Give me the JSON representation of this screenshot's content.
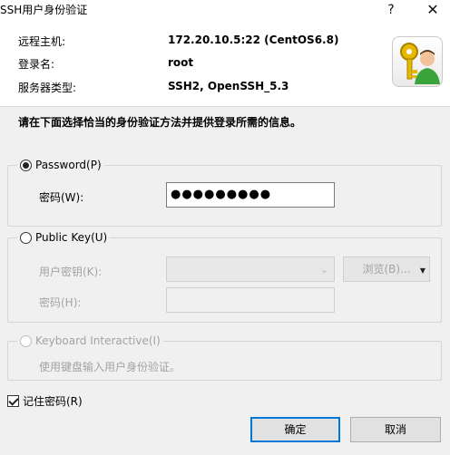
{
  "window": {
    "title": "SSH用户身份验证",
    "help_label": "?",
    "close_label": "✕"
  },
  "info": {
    "host_label": "远程主机:",
    "host_value": "172.20.10.5:22 (CentOS6.8)",
    "login_label": "登录名:",
    "login_value": "root",
    "server_label": "服务器类型:",
    "server_value": "SSH2, OpenSSH_5.3"
  },
  "instruction": "请在下面选择恰当的身份验证方法并提供登录所需的信息。",
  "password_group": {
    "label": "Password(P)",
    "selected": true,
    "password_label": "密码(W):",
    "password_value": "●●●●●●●●●"
  },
  "publickey_group": {
    "label": "Public Key(U)",
    "selected": false,
    "user_key_label": "用户密钥(K):",
    "user_key_value": "",
    "browse_label": "浏览(B)...",
    "passphrase_label": "密码(H):",
    "passphrase_value": ""
  },
  "keyboard_group": {
    "label": "Keyboard Interactive(I)",
    "selected": false,
    "description": "使用键盘输入用户身份验证。"
  },
  "remember_password": {
    "label": "记住密码(R)",
    "checked": true
  },
  "buttons": {
    "ok_label": "确定",
    "cancel_label": "取消"
  },
  "colors": {
    "accent": "#0078d7",
    "panel": "#f0f0f0"
  }
}
